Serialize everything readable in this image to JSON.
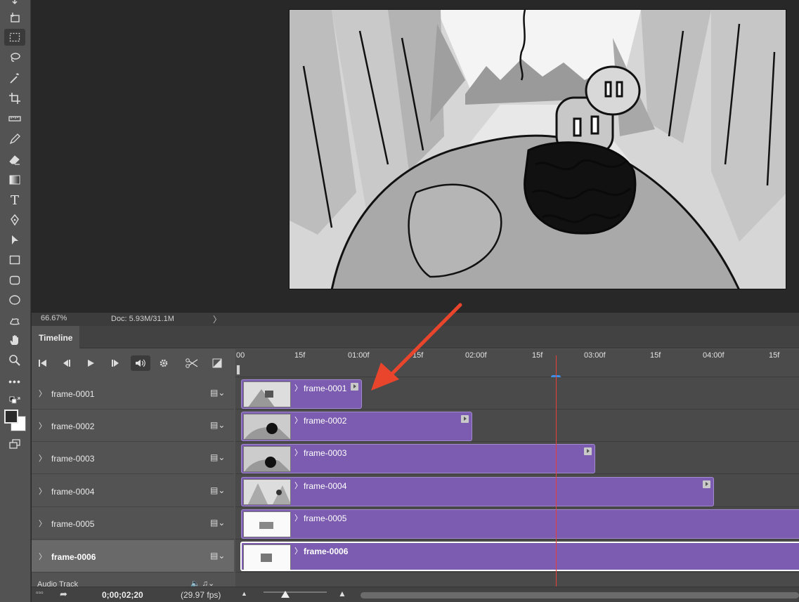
{
  "canvas": {
    "zoom": "66.67%",
    "doc_info": "Doc: 5.93M/31.1M",
    "status_menu": "〉"
  },
  "timeline": {
    "tab": "Timeline",
    "ruler_labels": [
      "00",
      "15f",
      "01:00f",
      "15f",
      "02:00f",
      "15f",
      "03:00f",
      "15f",
      "04:00f",
      "15f"
    ],
    "layers": [
      {
        "name": "frame-0001",
        "clip_label": "frame-0001"
      },
      {
        "name": "frame-0002",
        "clip_label": "frame-0002"
      },
      {
        "name": "frame-0003",
        "clip_label": "frame-0003"
      },
      {
        "name": "frame-0004",
        "clip_label": "frame-0004"
      },
      {
        "name": "frame-0005",
        "clip_label": "frame-0005"
      },
      {
        "name": "frame-0006",
        "clip_label": "frame-0006"
      }
    ],
    "selected_layer": "frame-0006",
    "audio_track": "Audio Track",
    "timecode": "0;00;02;20",
    "fps": "(29.97 fps)"
  },
  "colors": {
    "clip": "#7c5cb0",
    "playhead": "#e5413a",
    "annotation_arrow": "#e8452c"
  },
  "icons": {
    "tools": [
      "move-icon",
      "artboard-icon",
      "marquee-icon",
      "lasso-icon",
      "magic-wand-icon",
      "crop-icon",
      "ruler-icon",
      "brush-icon",
      "eraser-icon",
      "gradient-icon",
      "type-icon",
      "pen-icon",
      "path-select-icon",
      "rectangle-icon",
      "rounded-rect-icon",
      "ellipse-icon",
      "custom-shape-icon",
      "hand-icon",
      "zoom-icon",
      "more-icon"
    ]
  }
}
